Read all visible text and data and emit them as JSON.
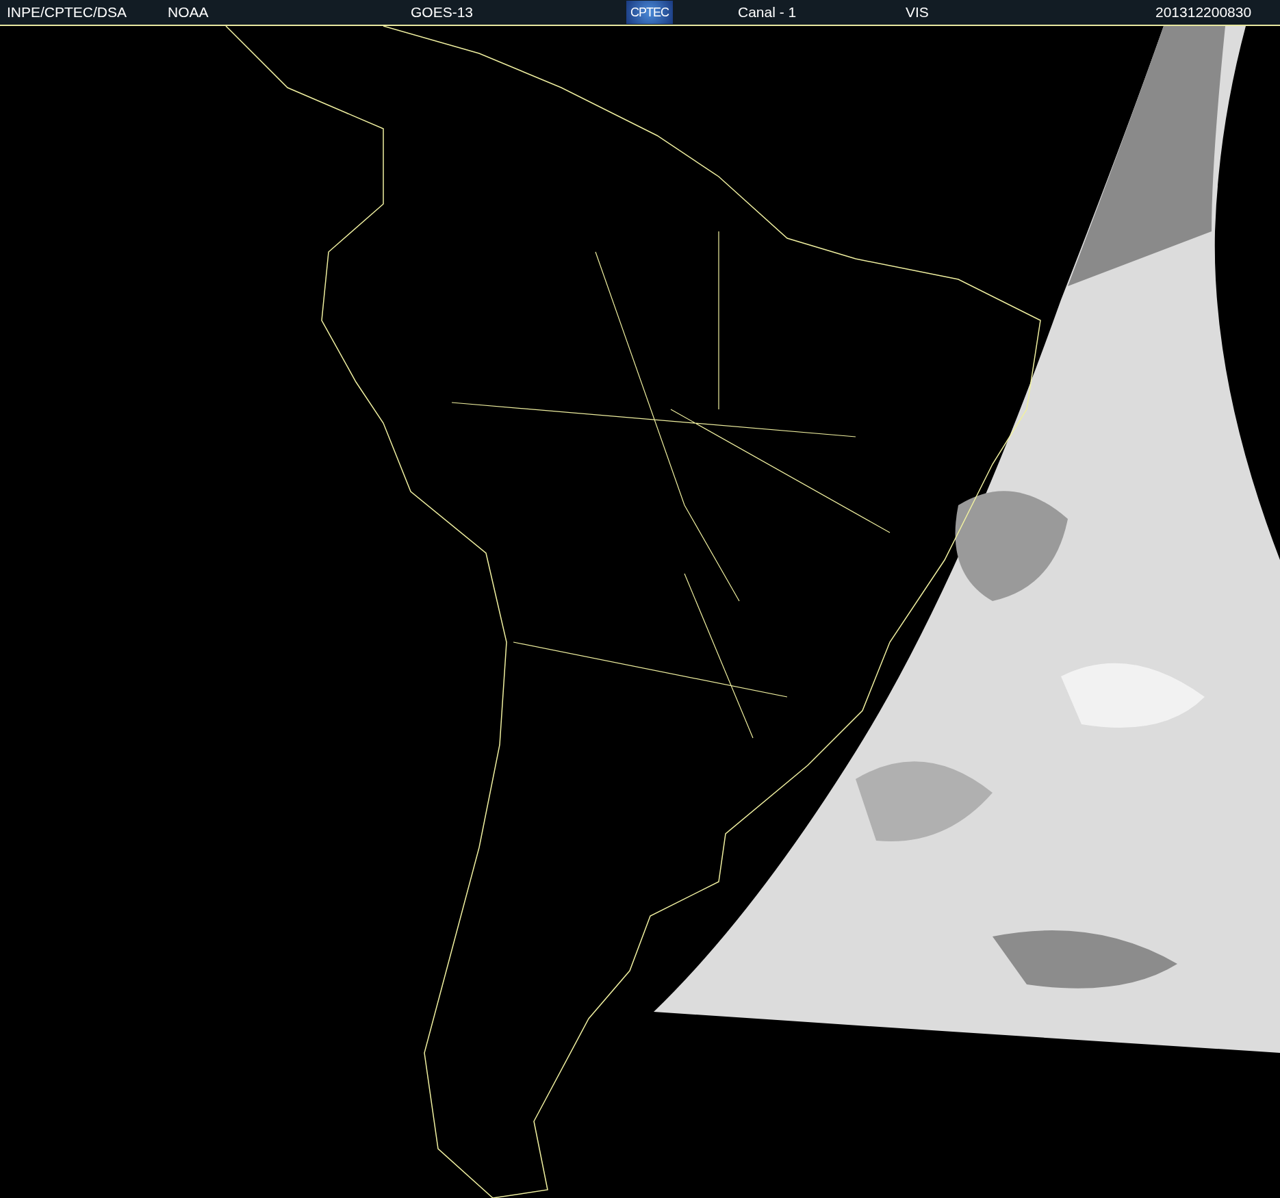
{
  "header": {
    "source": "INPE/CPTEC/DSA",
    "agency": "NOAA",
    "satellite": "GOES-13",
    "logo_text": "CPTEC",
    "channel": "Canal - 1",
    "band": "VIS",
    "timestamp": "201312200830"
  }
}
